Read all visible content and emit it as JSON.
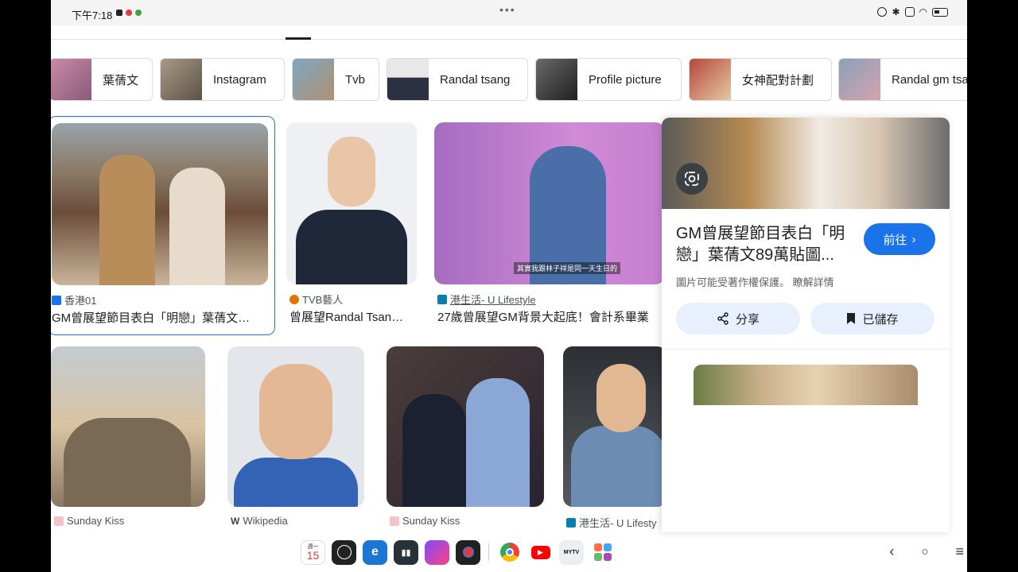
{
  "status_bar": {
    "time": "下午7:18",
    "dots": "•••"
  },
  "chips": [
    {
      "label": "葉蒨文",
      "color": "#c98ca8"
    },
    {
      "label": "Instagram",
      "color": "#a89a86"
    },
    {
      "label": "Tvb",
      "color": "#7ea7c4"
    },
    {
      "label": "Randal tsang",
      "color": "#3b4252"
    },
    {
      "label": "Profile picture",
      "color": "#4a4a4a"
    },
    {
      "label": "女神配對計劃",
      "color": "#b5473a"
    },
    {
      "label": "Randal gm tsa",
      "color": "#8ba0b8"
    }
  ],
  "results_row1": [
    {
      "source": "香港01",
      "title": "GM曾展望節目表白「明戀」葉蒨文…",
      "favicon_color": "#1a73e8"
    },
    {
      "source": "TVB藝人",
      "title": "曾展望Randal Tsan…",
      "favicon_color": "#e37400"
    },
    {
      "source": "港生活- U Lifestyle",
      "title": "27歲曾展望GM背景大起底！會計系畢業",
      "favicon_color": "#0b7fab",
      "caption": "其實我跟林子祥是同一天生日的"
    }
  ],
  "results_row2": [
    {
      "source": "Sunday Kiss",
      "favicon_color": "#f5c2c7"
    },
    {
      "source": "Wikipedia",
      "favicon_color": "#444444"
    },
    {
      "source": "Sunday Kiss",
      "favicon_color": "#f5c2c7"
    },
    {
      "source": "港生活- U Lifesty",
      "favicon_color": "#0b7fab"
    }
  ],
  "panel": {
    "title": "GM曾展望節目表白「明戀」葉蒨文89萬貼圖...",
    "visit_label": "前往",
    "copyright_note": "圖片可能受著作權保護。 瞭解詳情",
    "share_label": "分享",
    "saved_label": "已儲存"
  },
  "dock": {
    "calendar_weekday": "週一",
    "calendar_day": "15",
    "apps": [
      "calendar-icon",
      "clock-icon",
      "browser-icon",
      "recorder-icon",
      "gallery-icon",
      "camera-icon",
      "chrome-icon",
      "youtube-icon",
      "mytv-super-icon",
      "app-drawer-icon"
    ],
    "mytv_label": "MYTV"
  }
}
